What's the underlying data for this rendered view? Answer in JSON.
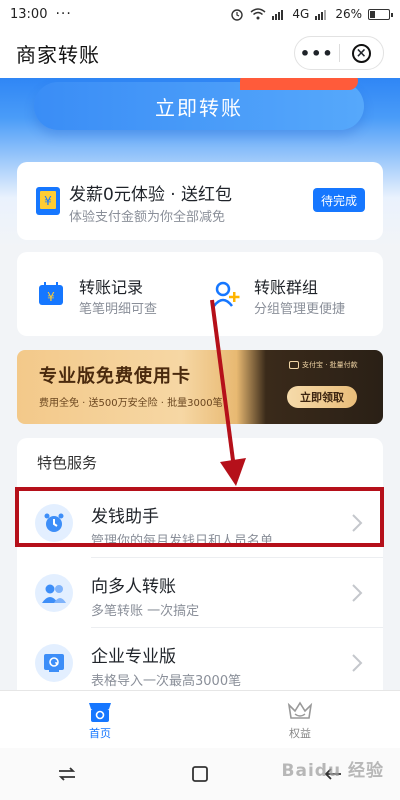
{
  "status_bar": {
    "time": "13:00",
    "dots": "···",
    "network": "4G",
    "battery": "26%"
  },
  "header": {
    "title": "商家转账",
    "more_label": "•••",
    "close_label": "×"
  },
  "transfer": {
    "button_label": "立即转账"
  },
  "promo_card": {
    "title": "发薪0元体验 · 送红包",
    "subtitle": "体验支付金额为你全部减免",
    "button_label": "待完成"
  },
  "quick_actions": [
    {
      "title": "转账记录",
      "subtitle": "笔笔明细可查",
      "icon": "calendar-yen-icon"
    },
    {
      "title": "转账群组",
      "subtitle": "分组管理更便捷",
      "icon": "user-add-icon"
    }
  ],
  "banner": {
    "title": "专业版免费使用卡",
    "subtitle": "费用全免 · 送500万安全险 · 批量3000笔",
    "brand": "支付宝 · 批量付款",
    "button_label": "立即领取"
  },
  "services": {
    "heading": "特色服务",
    "items": [
      {
        "title": "发钱助手",
        "subtitle": "管理你的每月发钱日和人员名单",
        "icon": "alarm-clock-icon"
      },
      {
        "title": "向多人转账",
        "subtitle": "多笔转账 一次搞定",
        "icon": "multi-user-icon"
      },
      {
        "title": "企业专业版",
        "subtitle": "表格导入一次最高3000笔",
        "icon": "enterprise-icon"
      }
    ]
  },
  "tabs": [
    {
      "label": "首页",
      "icon": "home-store-icon",
      "active": true
    },
    {
      "label": "权益",
      "icon": "crown-icon",
      "active": false
    }
  ],
  "colors": {
    "primary": "#1677ff",
    "highlight": "#b5101a",
    "banner_gold": "#f3c98a"
  },
  "watermark": "Baidu 经验"
}
